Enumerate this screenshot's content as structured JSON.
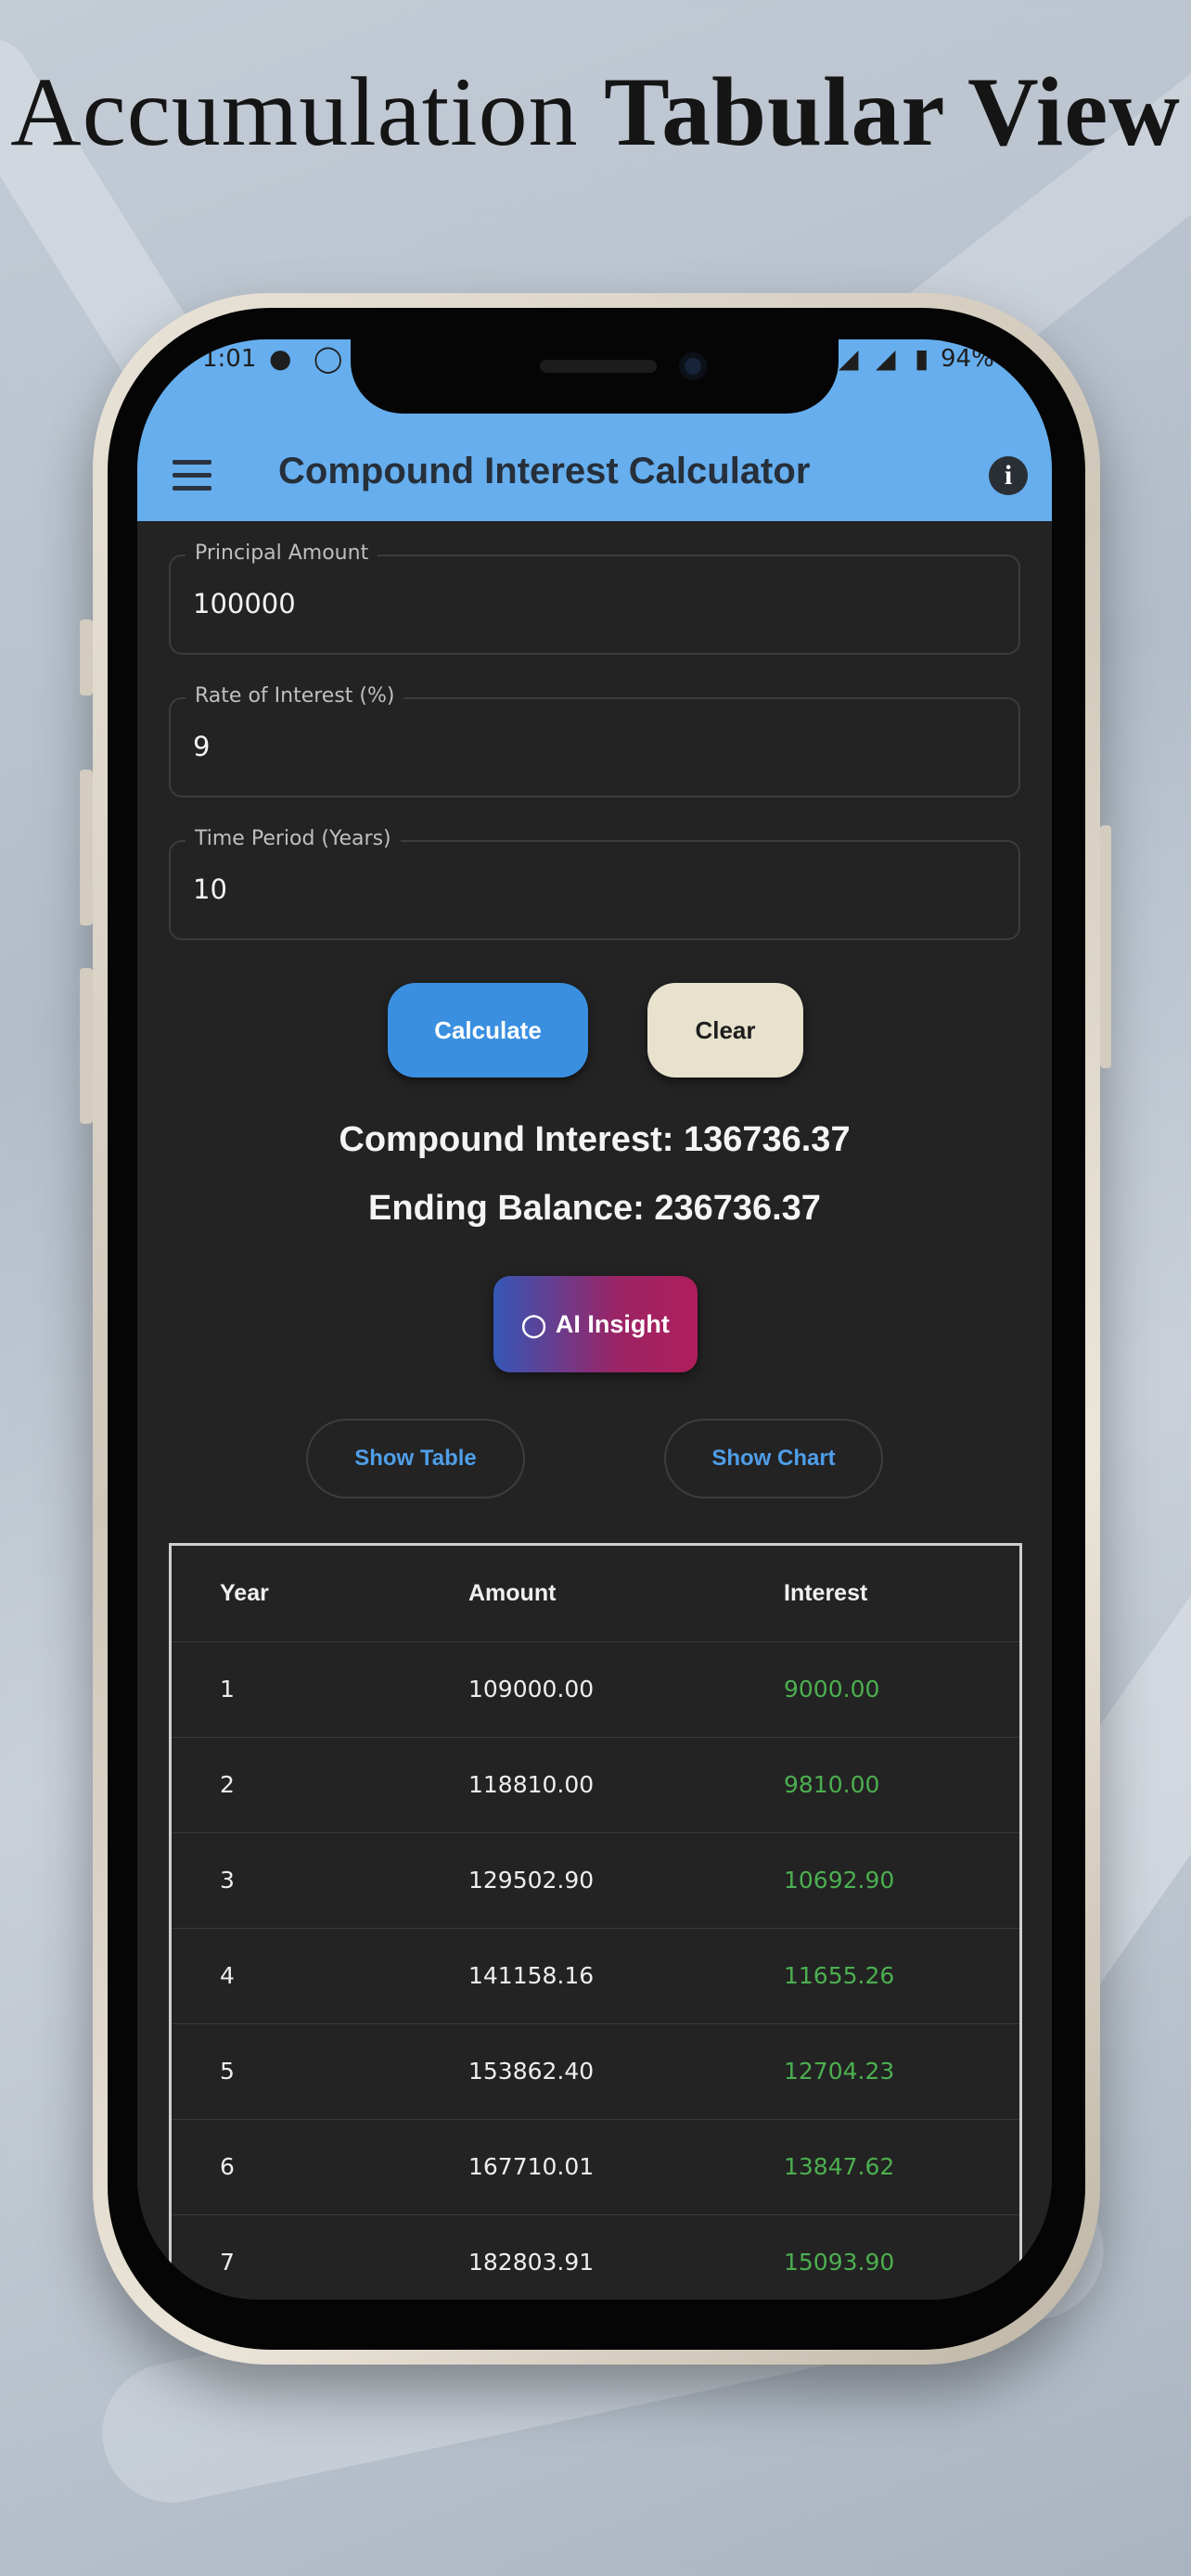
{
  "headline": {
    "regular": "Accumulation",
    "bold": "Tabular View"
  },
  "status_bar": {
    "time": "1:01",
    "battery": "94%"
  },
  "app_bar": {
    "title": "Compound Interest Calculator"
  },
  "form": {
    "principal": {
      "label": "Principal Amount",
      "value": "100000"
    },
    "rate": {
      "label": "Rate of Interest (%)",
      "value": "9"
    },
    "period": {
      "label": "Time Period (Years)",
      "value": "10"
    }
  },
  "buttons": {
    "calculate": "Calculate",
    "clear": "Clear",
    "ai_insight": "AI Insight",
    "show_table": "Show Table",
    "show_chart": "Show Chart"
  },
  "results": {
    "compound_interest": "Compound Interest: 136736.37",
    "ending_balance": "Ending Balance: 236736.37"
  },
  "table": {
    "headers": [
      "Year",
      "Amount",
      "Interest"
    ],
    "rows": [
      [
        "1",
        "109000.00",
        "9000.00"
      ],
      [
        "2",
        "118810.00",
        "9810.00"
      ],
      [
        "3",
        "129502.90",
        "10692.90"
      ],
      [
        "4",
        "141158.16",
        "11655.26"
      ],
      [
        "5",
        "153862.40",
        "12704.23"
      ],
      [
        "6",
        "167710.01",
        "13847.62"
      ],
      [
        "7",
        "182803.91",
        "15093.90"
      ]
    ]
  },
  "colors": {
    "app_bar": "#66aeee",
    "background": "#232323",
    "accent": "#3a8fe0",
    "interest_green": "#4caf50"
  }
}
